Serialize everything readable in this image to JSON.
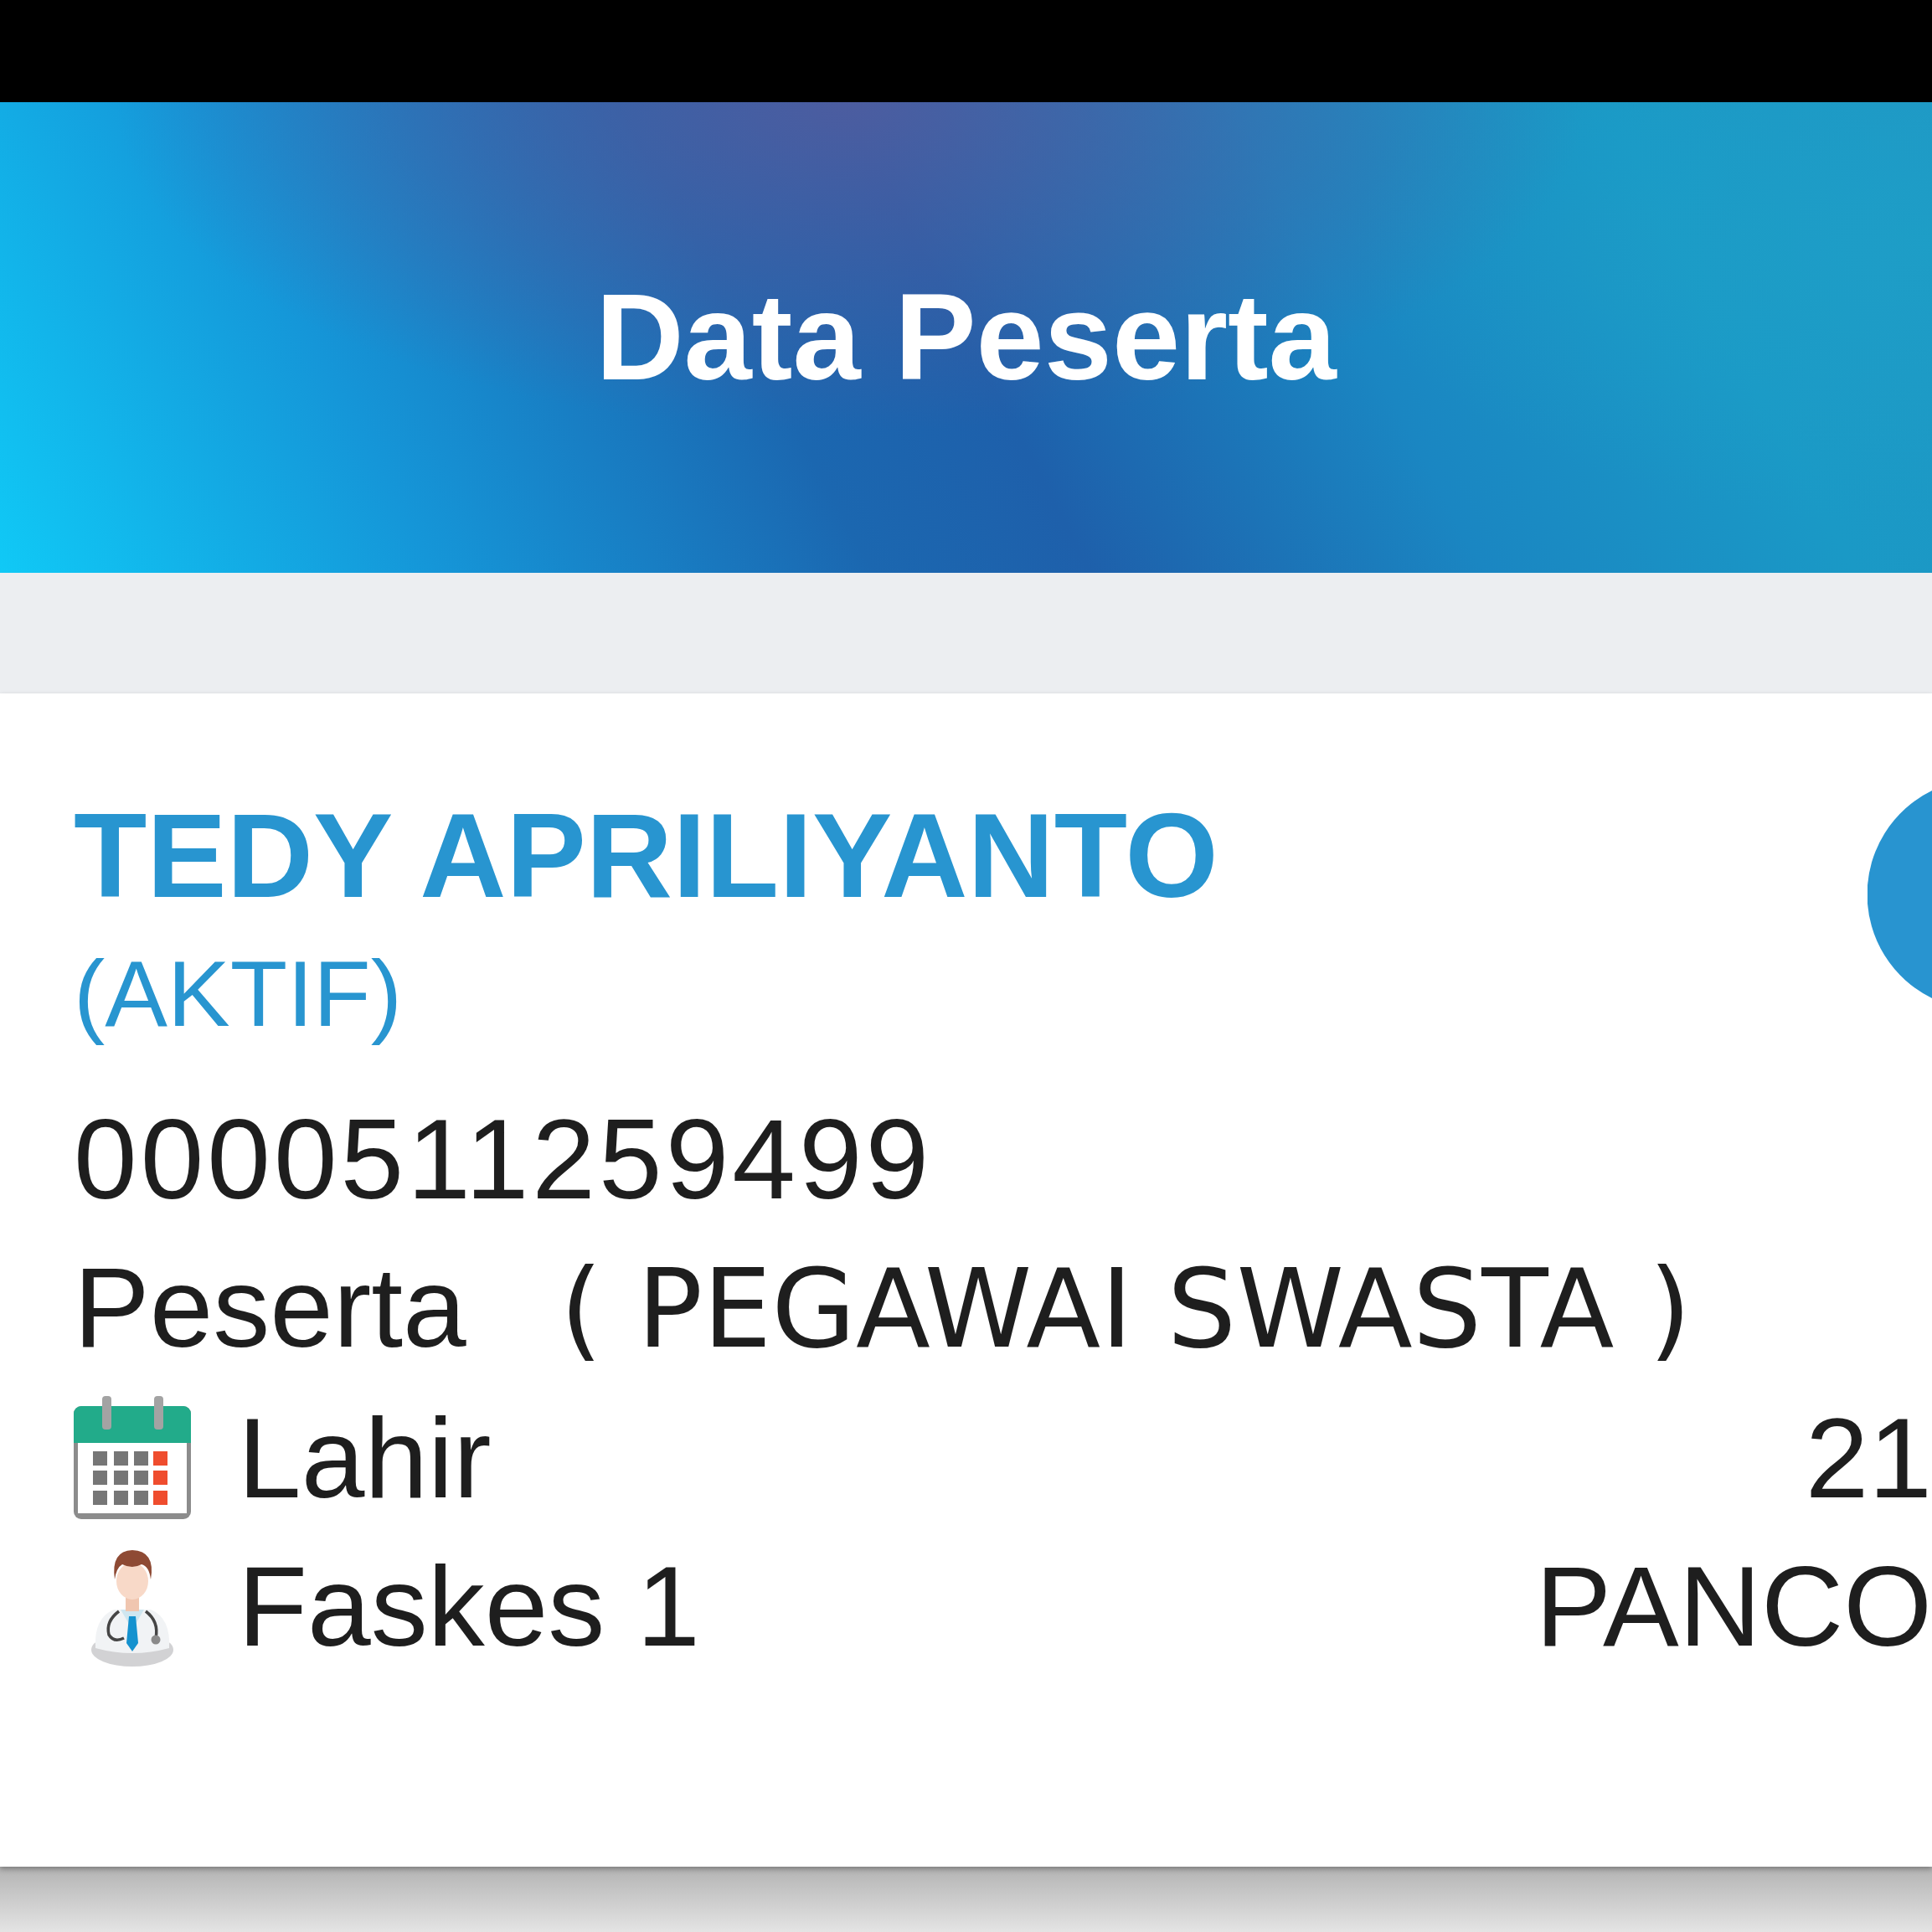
{
  "header": {
    "title": "Data Peserta"
  },
  "participant": {
    "name": "TEDY APRILIYANTO",
    "status": "(AKTIF)",
    "card_number": "0000511259499",
    "type_label": "Peserta",
    "type_value": "( PEGAWAI SWASTA )"
  },
  "details": [
    {
      "kind": "calendar",
      "label": "Lahir",
      "value": "21"
    },
    {
      "kind": "doctor",
      "label": "Faskes 1",
      "value": "PANCO"
    }
  ]
}
